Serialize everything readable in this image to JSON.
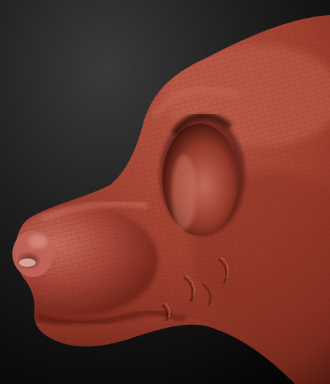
{
  "viewport": {
    "background_top": "#3a3a3a",
    "background_bottom": "#050505"
  },
  "model": {
    "kind": "sculpted creature head, side view, muzzle facing left",
    "material_color": "#a2402f",
    "highlight_color": "#c96d5c",
    "shadow_color": "#3d1009",
    "wireframe": true,
    "wireframe_color": "#5e1c12"
  }
}
